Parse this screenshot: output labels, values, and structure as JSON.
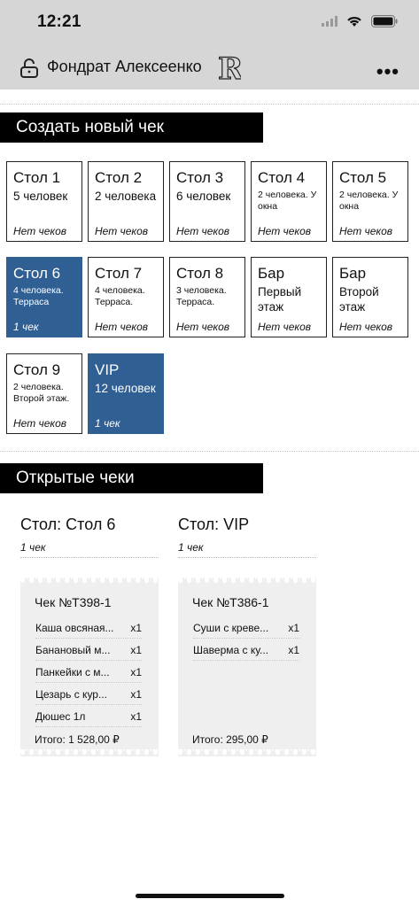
{
  "status_bar": {
    "time": "12:21"
  },
  "header": {
    "user_name": "Фондрат Алексеенко",
    "logo_letter": "R",
    "more": "•••"
  },
  "create_section": {
    "title": "Создать новый чек"
  },
  "tables": [
    {
      "name": "Стол 1",
      "desc": "5 человек",
      "small": false,
      "status": "Нет чеков",
      "active": false
    },
    {
      "name": "Стол 2",
      "desc": "2 человека",
      "small": false,
      "status": "Нет чеков",
      "active": false
    },
    {
      "name": "Стол 3",
      "desc": "6 человек",
      "small": false,
      "status": "Нет чеков",
      "active": false
    },
    {
      "name": "Стол 4",
      "desc": "2 человека. У окна",
      "small": true,
      "status": "Нет чеков",
      "active": false
    },
    {
      "name": "Стол 5",
      "desc": "2 человека. У окна",
      "small": true,
      "status": "Нет чеков",
      "active": false
    },
    {
      "name": "Стол 6",
      "desc": "4 человека. Терраса",
      "small": true,
      "status": "1 чек",
      "active": true
    },
    {
      "name": "Стол 7",
      "desc": "4 человека. Терраса.",
      "small": true,
      "status": "Нет чеков",
      "active": false
    },
    {
      "name": "Стол 8",
      "desc": "3 человека. Терраса.",
      "small": true,
      "status": "Нет чеков",
      "active": false
    },
    {
      "name": "Бар",
      "desc": "Первый этаж",
      "small": false,
      "status": "Нет чеков",
      "active": false
    },
    {
      "name": "Бар",
      "desc": "Второй этаж",
      "small": false,
      "status": "Нет чеков",
      "active": false
    },
    {
      "name": "Стол 9",
      "desc": "2 человека. Второй этаж.",
      "small": true,
      "status": "Нет чеков",
      "active": false
    },
    {
      "name": "VIP",
      "desc": "12 человек",
      "small": false,
      "status": "1 чек",
      "active": true
    }
  ],
  "open_section": {
    "title": "Открытые чеки"
  },
  "open_checks": [
    {
      "table_label": "Стол: Стол 6",
      "count": "1 чек",
      "check_title": "Чек №Т398-1",
      "items": [
        {
          "name": "Каша овсяная...",
          "qty": "x1"
        },
        {
          "name": "Банановый м...",
          "qty": "x1"
        },
        {
          "name": "Панкейки с м...",
          "qty": "x1"
        },
        {
          "name": "Цезарь с кур...",
          "qty": "x1"
        },
        {
          "name": "Дюшес 1л",
          "qty": "x1"
        }
      ],
      "total": "Итого: 1 528,00 ₽"
    },
    {
      "table_label": "Стол: VIP",
      "count": "1 чек",
      "check_title": "Чек №Т386-1",
      "items": [
        {
          "name": "Суши с креве...",
          "qty": "x1"
        },
        {
          "name": "Шаверма с ку...",
          "qty": "x1"
        }
      ],
      "total": "Итого: 295,00 ₽"
    }
  ],
  "colors": {
    "active_card": "#2f5f93",
    "header_bg": "#d6d6d6",
    "receipt_bg": "#efefef"
  }
}
